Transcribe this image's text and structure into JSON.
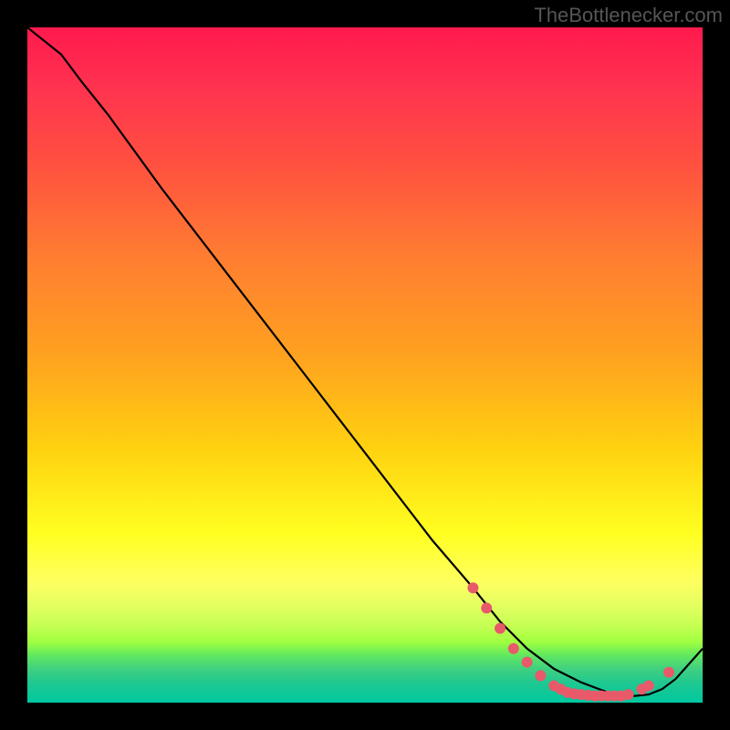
{
  "attribution": "TheBottlenecker.com",
  "chart_data": {
    "type": "line",
    "title": "",
    "xlabel": "",
    "ylabel": "",
    "xlim": [
      0,
      100
    ],
    "ylim": [
      0,
      100
    ],
    "series": [
      {
        "name": "curve",
        "x": [
          0,
          5,
          8,
          12,
          20,
          30,
          40,
          50,
          60,
          66,
          70,
          74,
          78,
          82,
          86,
          88,
          90,
          92,
          94,
          96,
          100
        ],
        "values": [
          100,
          96,
          92,
          87,
          76,
          63,
          50,
          37,
          24,
          17,
          12,
          8,
          5,
          3,
          1.5,
          1,
          1,
          1.2,
          2,
          3.5,
          8
        ]
      }
    ],
    "points": [
      {
        "x": 66,
        "y": 17
      },
      {
        "x": 68,
        "y": 14
      },
      {
        "x": 70,
        "y": 11
      },
      {
        "x": 72,
        "y": 8
      },
      {
        "x": 74,
        "y": 6
      },
      {
        "x": 76,
        "y": 4
      },
      {
        "x": 78,
        "y": 2.5
      },
      {
        "x": 79,
        "y": 2
      },
      {
        "x": 80,
        "y": 1.5
      },
      {
        "x": 81,
        "y": 1.3
      },
      {
        "x": 82,
        "y": 1.2
      },
      {
        "x": 83,
        "y": 1.1
      },
      {
        "x": 84,
        "y": 1.0
      },
      {
        "x": 85,
        "y": 1.0
      },
      {
        "x": 86,
        "y": 1.0
      },
      {
        "x": 87,
        "y": 1.0
      },
      {
        "x": 88,
        "y": 1.0
      },
      {
        "x": 89,
        "y": 1.2
      },
      {
        "x": 91,
        "y": 2.0
      },
      {
        "x": 92,
        "y": 2.5
      },
      {
        "x": 95,
        "y": 4.5
      }
    ]
  }
}
